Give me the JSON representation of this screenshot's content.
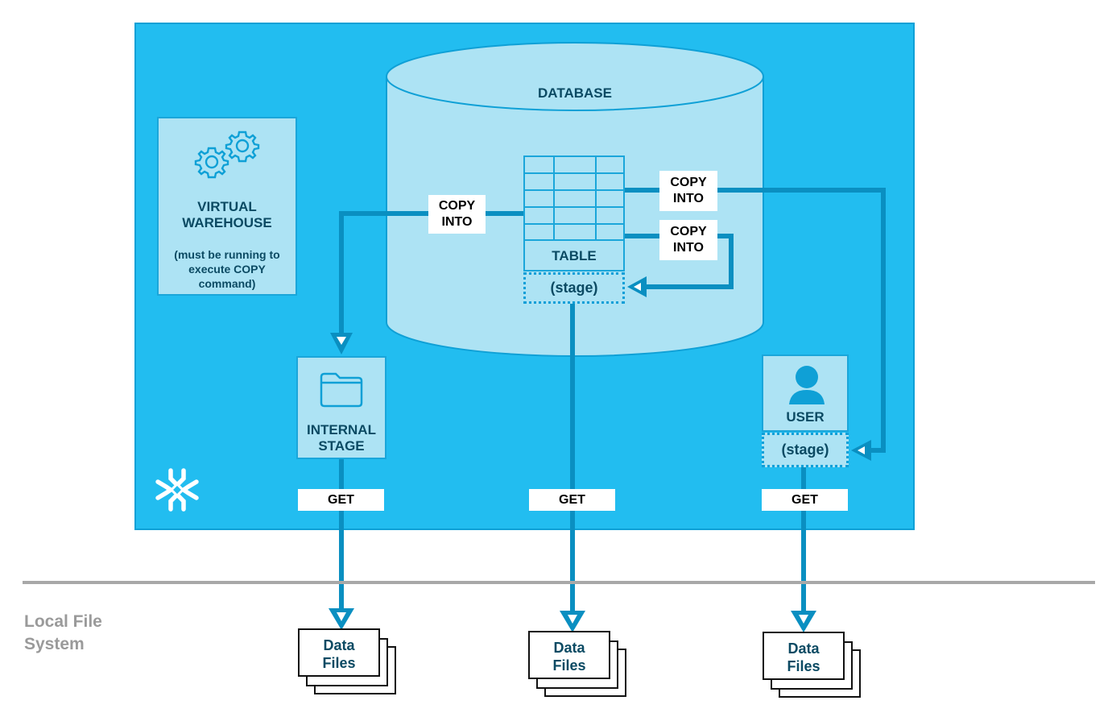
{
  "cloud_platform": {
    "logo_icon": "snowflake-icon",
    "virtual_warehouse": {
      "icon": "gears-icon",
      "title_line1": "VIRTUAL",
      "title_line2": "WAREHOUSE",
      "note_line1": "(must be running to",
      "note_line2": "execute COPY",
      "note_line3": "command)"
    },
    "database": {
      "label": "DATABASE",
      "table": {
        "label": "TABLE",
        "stage_label": "(stage)",
        "icon": "table-grid-icon"
      }
    },
    "internal_stage": {
      "icon": "folder-icon",
      "line1": "INTERNAL",
      "line2": "STAGE"
    },
    "user": {
      "icon": "user-icon",
      "label": "USER",
      "stage_label": "(stage)"
    }
  },
  "flows": {
    "copy_into_internal": {
      "line1": "COPY",
      "line2": "INTO"
    },
    "copy_into_user": {
      "line1": "COPY",
      "line2": "INTO"
    },
    "copy_into_table_stage": {
      "line1": "COPY",
      "line2": "INTO"
    },
    "get_internal": "GET",
    "get_table": "GET",
    "get_user": "GET"
  },
  "local_file_system": {
    "label_line1": "Local File",
    "label_line2": "System",
    "data_files": [
      {
        "line1": "Data",
        "line2": "Files"
      },
      {
        "line1": "Data",
        "line2": "Files"
      },
      {
        "line1": "Data",
        "line2": "Files"
      }
    ]
  },
  "colors": {
    "cloud_bg": "#22bdf0",
    "panel_bg": "#ade3f4",
    "arrow": "#0a8fc1",
    "text_dark": "#0b4a63",
    "local_label": "#9a9a9a",
    "divider": "#a8a8a8"
  }
}
